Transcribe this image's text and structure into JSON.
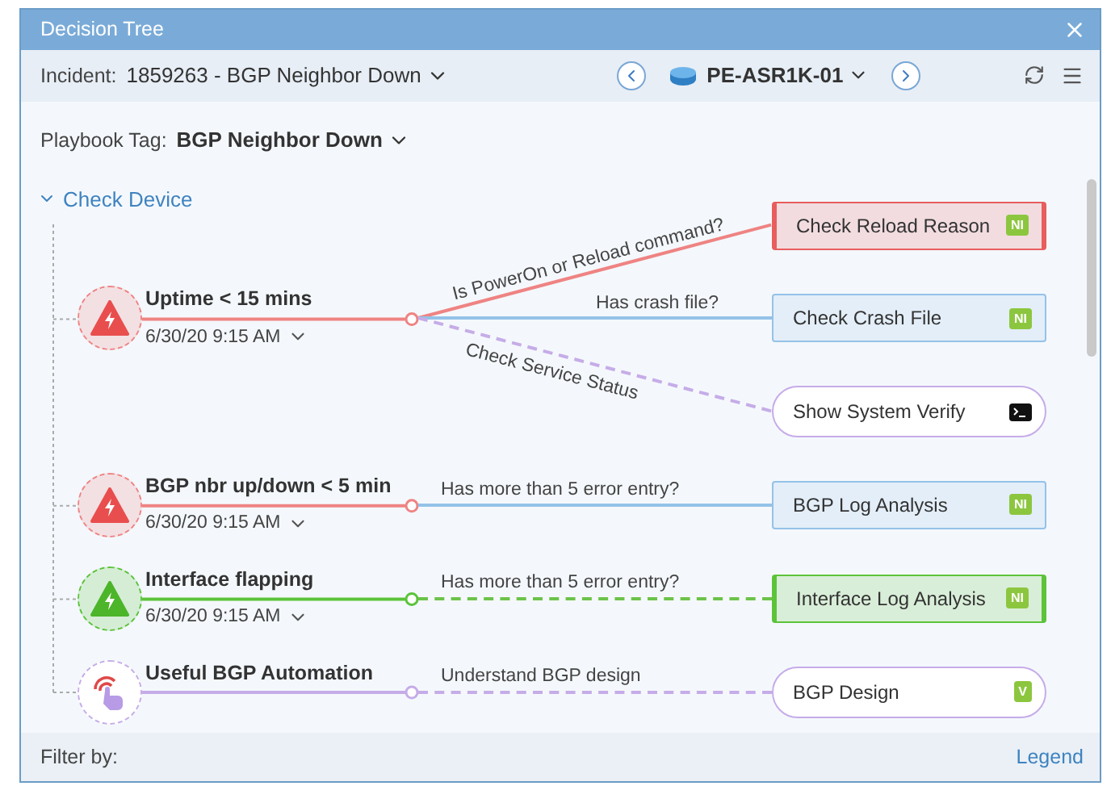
{
  "window": {
    "title": "Decision Tree"
  },
  "header": {
    "incident_label": "Incident:",
    "incident": "1859263 - BGP Neighbor Down",
    "device": "PE-ASR1K-01"
  },
  "playbook": {
    "label": "Playbook Tag:",
    "value": "BGP Neighbor Down"
  },
  "tree": {
    "label": "Check Device",
    "expanded": true,
    "triggers": [
      {
        "kind": "alert",
        "color": "#ef8383",
        "title": "Uptime < 15 mins",
        "time": "6/30/20 9:15 AM",
        "branches": [
          {
            "label": "Is PowerOn or Reload command?",
            "color": "#ef8383",
            "dashed": false,
            "action": {
              "kind": "box",
              "label": "Check Reload Reason",
              "color": "#e85d5d",
              "highlighted": true,
              "badge": {
                "kind": "text",
                "text": "NI"
              }
            }
          },
          {
            "label": "Has crash file?",
            "color": "#94c2e8",
            "dashed": false,
            "action": {
              "kind": "box",
              "label": "Check Crash File",
              "color": "#94c2e8",
              "highlighted": false,
              "badge": {
                "kind": "text",
                "text": "NI"
              }
            }
          },
          {
            "label": "Check Service Status",
            "color": "#c6ace8",
            "dashed": true,
            "action": {
              "kind": "pill",
              "label": "Show System Verify",
              "color": "#c6ace8",
              "highlighted": false,
              "badge": {
                "kind": "terminal"
              }
            }
          }
        ]
      },
      {
        "kind": "alert",
        "color": "#ef8383",
        "title": "BGP nbr up/down < 5 min",
        "time": "6/30/20 9:15 AM",
        "branches": [
          {
            "label": "Has more than 5 error entry?",
            "color": "#94c2e8",
            "dashed": false,
            "action": {
              "kind": "box",
              "label": "BGP Log Analysis",
              "color": "#94c2e8",
              "highlighted": false,
              "badge": {
                "kind": "text",
                "text": "NI"
              }
            }
          }
        ]
      },
      {
        "kind": "alert",
        "color": "#5cc33a",
        "title": "Interface flapping",
        "time": "6/30/20 9:15 AM",
        "branches": [
          {
            "label": "Has more than 5 error entry?",
            "color": "#6cc34a",
            "dashed": true,
            "action": {
              "kind": "box",
              "label": "Interface Log Analysis",
              "color": "#5cc33a",
              "highlighted": true,
              "badge": {
                "kind": "text",
                "text": "NI"
              }
            }
          }
        ]
      },
      {
        "kind": "automation",
        "color": "#c6ace8",
        "title": "Useful BGP Automation",
        "branches": [
          {
            "label": "Understand BGP design",
            "color": "#c6ace8",
            "dashed": true,
            "action": {
              "kind": "pill",
              "label": "BGP Design",
              "color": "#c6ace8",
              "highlighted": false,
              "badge": {
                "kind": "text",
                "text": "V"
              }
            }
          }
        ]
      }
    ]
  },
  "footer": {
    "filter_label": "Filter by:",
    "legend": "Legend"
  }
}
